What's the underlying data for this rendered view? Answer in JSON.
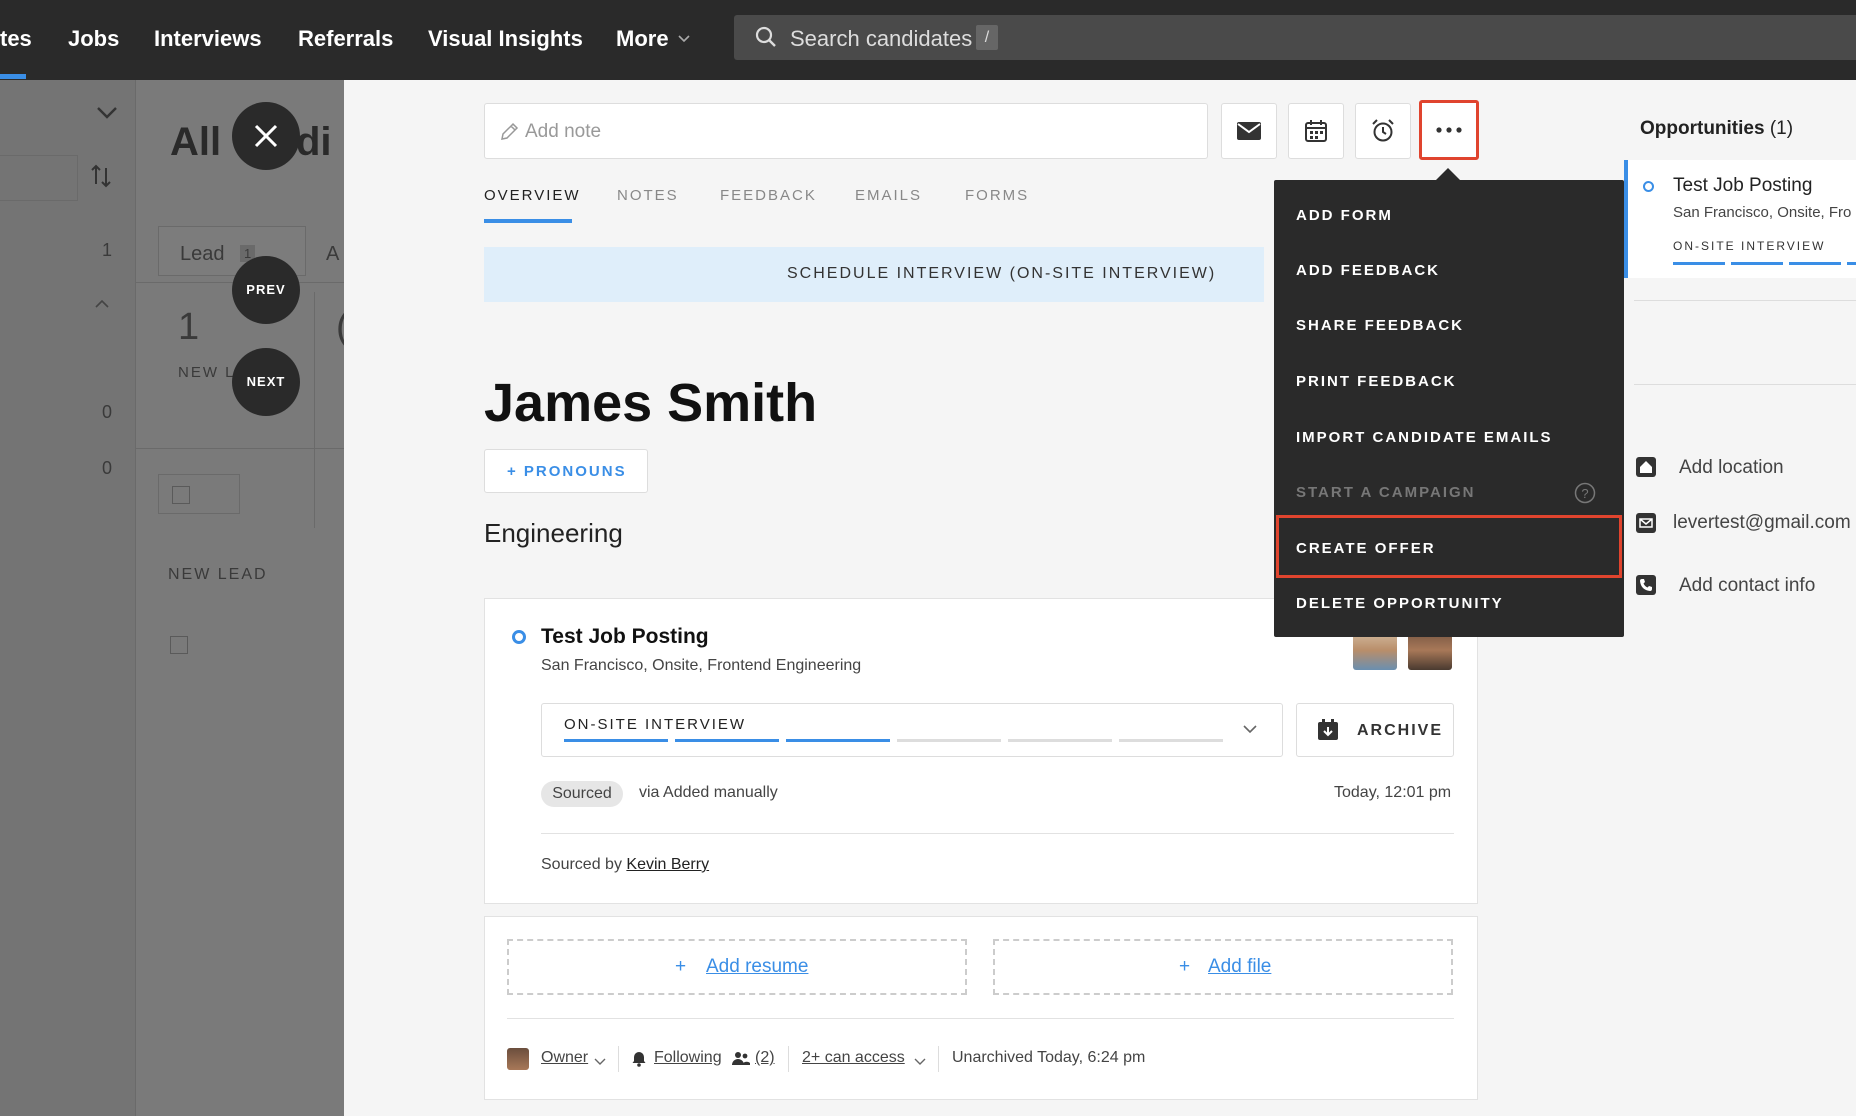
{
  "nav": {
    "items": [
      "tes",
      "Jobs",
      "Interviews",
      "Referrals",
      "Visual Insights",
      "More"
    ],
    "search_placeholder": "Search candidates",
    "search_shortcut": "/"
  },
  "background": {
    "title_part1": "All",
    "title_part2": "di",
    "tab_lead": "Lead",
    "tab_lead_count": "1",
    "tab_next": "A",
    "count_1": "1",
    "stat_number": "1",
    "stat_label": "NEW L",
    "stat_label_partial": "(",
    "zero_1": "0",
    "zero_2": "0",
    "new_lead": "NEW LEAD"
  },
  "nav_circles": {
    "prev": "PREV",
    "next": "NEXT"
  },
  "toolbar": {
    "note_placeholder": "Add note"
  },
  "tabs": [
    "OVERVIEW",
    "NOTES",
    "FEEDBACK",
    "EMAILS",
    "FORMS"
  ],
  "schedule_banner": "SCHEDULE INTERVIEW (ON-SITE INTERVIEW)",
  "candidate": {
    "name": "James Smith",
    "pronouns_button": "+ PRONOUNS",
    "department": "Engineering"
  },
  "opportunity": {
    "title": "Test Job Posting",
    "subtitle": "San Francisco, Onsite, Frontend Engineering",
    "stage": "ON-SITE INTERVIEW",
    "stage_progress": {
      "completed": 3,
      "total": 6
    },
    "archive_label": "ARCHIVE",
    "source_badge": "Sourced",
    "source_via": "via Added manually",
    "timestamp": "Today, 12:01 pm",
    "sourced_by_prefix": "Sourced by",
    "sourced_by_name": "Kevin Berry"
  },
  "files": {
    "add_resume": "Add resume",
    "add_file": "Add file",
    "owner_label": "Owner",
    "following_label": "Following",
    "followers_count": "(2)",
    "access_label": "2+ can access",
    "unarchived": "Unarchived Today, 6:24 pm"
  },
  "menu": {
    "items": [
      {
        "label": "ADD FORM",
        "disabled": false
      },
      {
        "label": "ADD FEEDBACK",
        "disabled": false
      },
      {
        "label": "SHARE FEEDBACK",
        "disabled": false
      },
      {
        "label": "PRINT FEEDBACK",
        "disabled": false
      },
      {
        "label": "IMPORT CANDIDATE EMAILS",
        "disabled": false
      },
      {
        "label": "START A CAMPAIGN",
        "disabled": true
      },
      {
        "label": "CREATE OFFER",
        "disabled": false,
        "highlighted": true
      },
      {
        "label": "DELETE OPPORTUNITY",
        "disabled": false
      }
    ]
  },
  "sidebar": {
    "opportunities_label": "Opportunities",
    "opportunities_count": "(1)",
    "opp_title": "Test Job Posting",
    "opp_subtitle": "San Francisco, Onsite, Fro",
    "opp_stage": "ON-SITE INTERVIEW",
    "add_location": "Add location",
    "email": "levertest@gmail.com",
    "add_contact": "Add contact info"
  },
  "colors": {
    "accent": "#3a8ee6",
    "highlight": "#e0442e",
    "nav_bg": "#2a2a2a"
  }
}
